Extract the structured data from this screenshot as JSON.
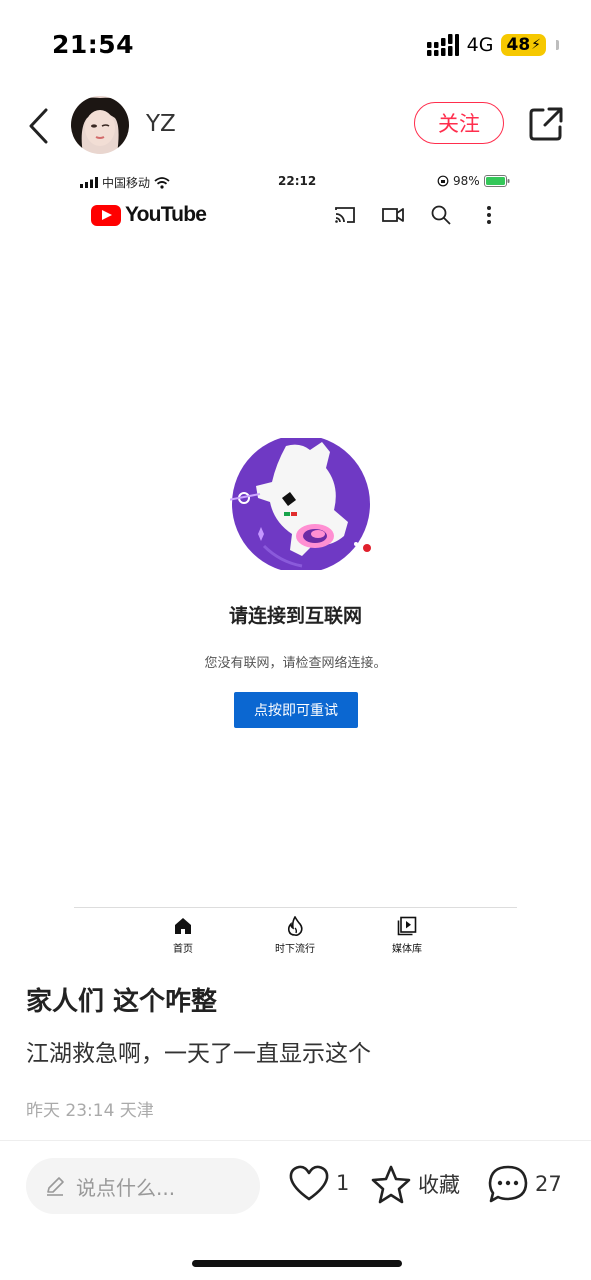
{
  "status_bar": {
    "time": "21:54",
    "network": "4G",
    "battery": "48"
  },
  "post_header": {
    "username": "YZ",
    "follow_label": "关注"
  },
  "inner_status": {
    "carrier": "中国移动",
    "time": "22:12",
    "battery": "98%"
  },
  "youtube": {
    "logo_text": "YouTube",
    "error_title": "请连接到互联网",
    "error_desc": "您没有联网，请检查网络连接。",
    "retry_label": "点按即可重试",
    "tabs": [
      {
        "label": "首页",
        "icon": "home-icon"
      },
      {
        "label": "时下流行",
        "icon": "trending-icon"
      },
      {
        "label": "媒体库",
        "icon": "library-icon"
      }
    ]
  },
  "post": {
    "title": "家人们 这个咋整",
    "body": "江湖救急啊，一天了一直显示这个",
    "meta": "昨天 23:14 天津"
  },
  "action_bar": {
    "comment_placeholder": "说点什么...",
    "likes": "1",
    "collect_label": "收藏",
    "comments": "27"
  },
  "colors": {
    "follow_red": "#ff2e4d",
    "retry_blue": "#0b67d1",
    "battery_yellow": "#f6c800",
    "youtube_red": "#ff0000"
  }
}
